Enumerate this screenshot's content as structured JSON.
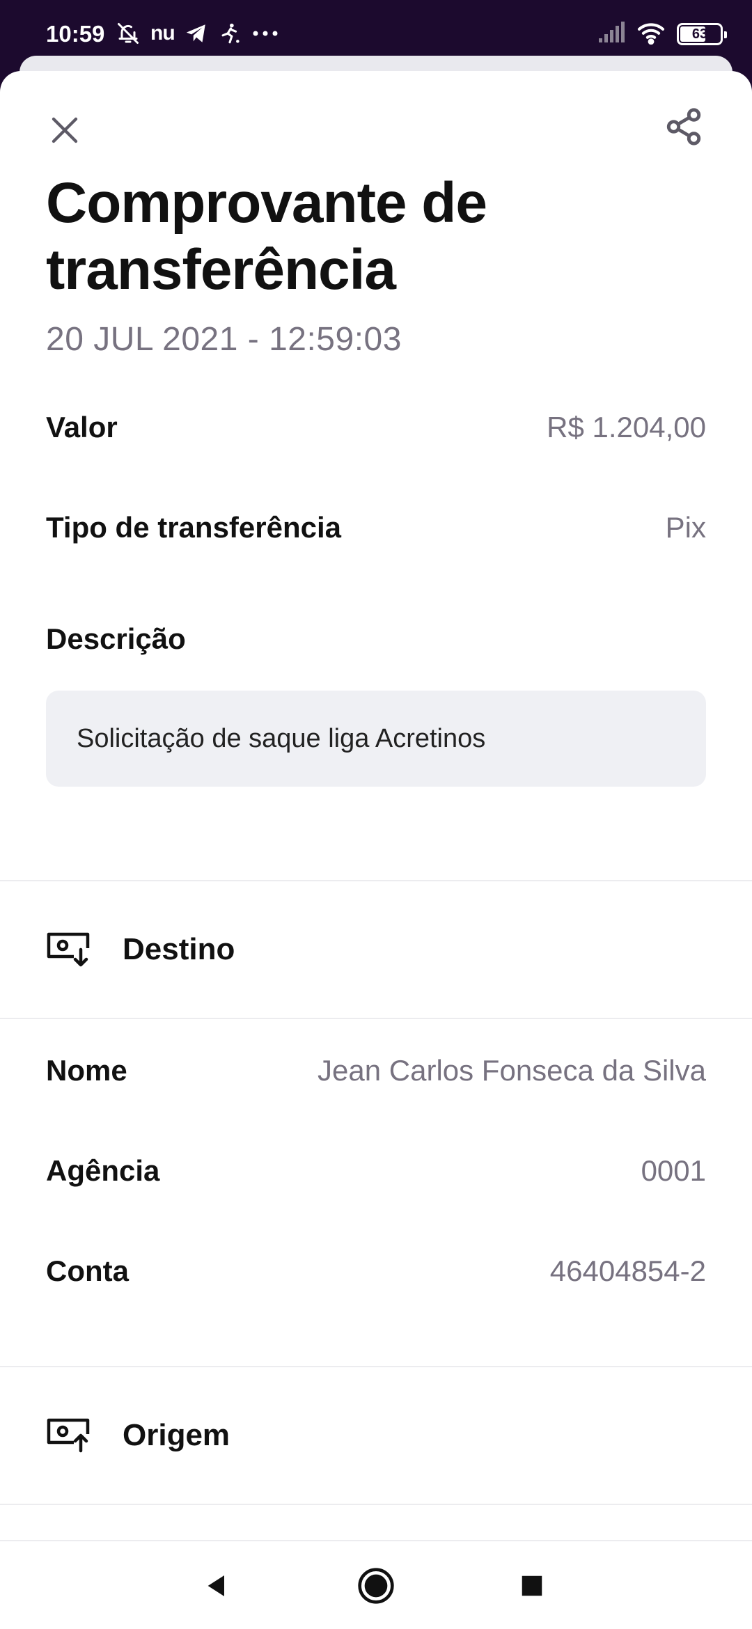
{
  "status_bar": {
    "time": "10:59",
    "nu_label": "nu",
    "battery_level": "63",
    "icons": [
      "muted-icon",
      "nubank-icon",
      "telegram-icon",
      "soccer-icon",
      "more-dots-icon",
      "signal-icon",
      "wifi-icon",
      "battery-icon"
    ]
  },
  "header": {
    "title_line1": "Comprovante de",
    "title_line2": "transferência",
    "date": "20 JUL 2021 - 12:59:03",
    "close_icon": "close-icon",
    "share_icon": "share-icon"
  },
  "summary": {
    "valor_label": "Valor",
    "valor_value": "R$ 1.204,00",
    "tipo_label": "Tipo de transferência",
    "tipo_value": "Pix",
    "descricao_label": "Descrição",
    "descricao_value": "Solicitação de saque liga Acretinos"
  },
  "destino": {
    "title": "Destino",
    "icon": "money-in-icon",
    "nome_label": "Nome",
    "nome_value": "Jean Carlos Fonseca da Silva",
    "agencia_label": "Agência",
    "agencia_value": "0001",
    "conta_label": "Conta",
    "conta_value": "46404854-2"
  },
  "origem": {
    "title": "Origem",
    "icon": "money-out-icon"
  },
  "nav_bar": {
    "icons": [
      "back-icon",
      "home-icon",
      "recents-icon"
    ]
  },
  "colors": {
    "status_bar_bg": "#1c0a2e",
    "muted_text": "#777280",
    "desc_box_bg": "#eff0f4",
    "divider": "#ececef"
  }
}
